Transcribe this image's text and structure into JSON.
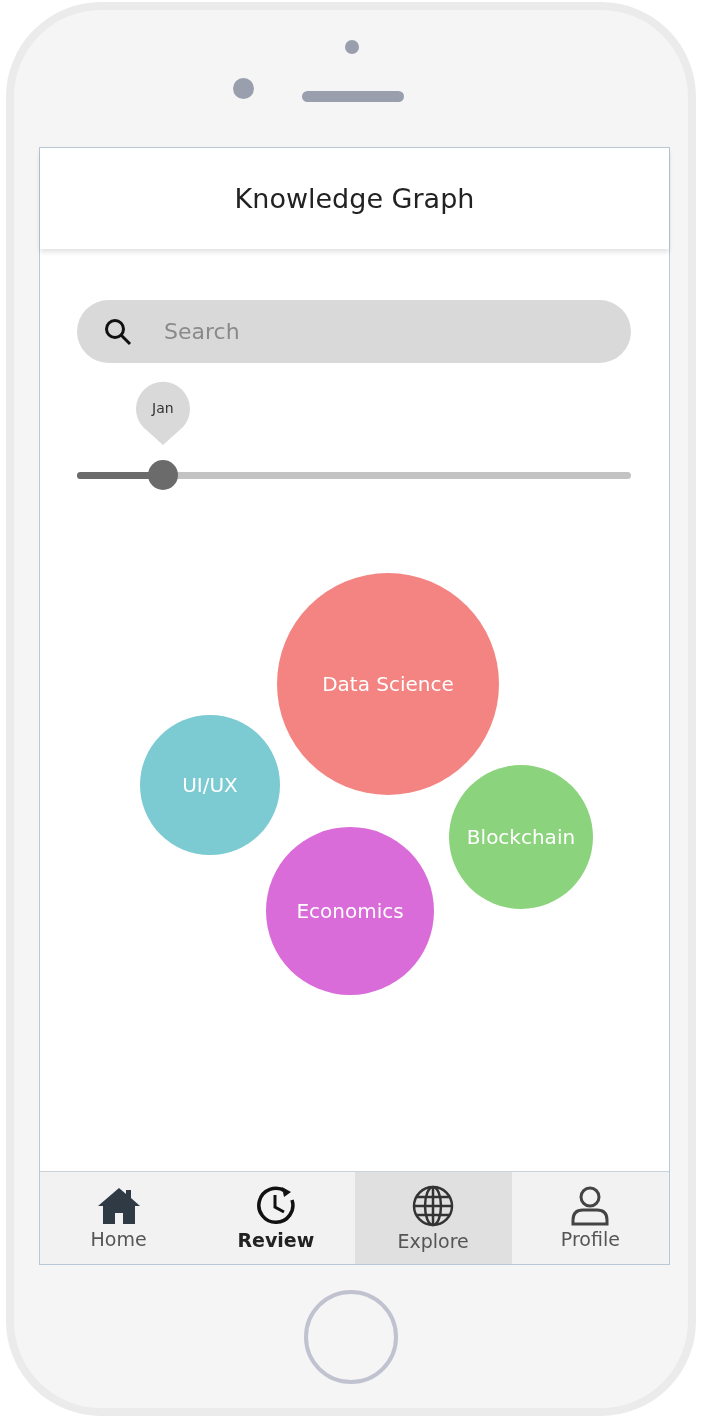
{
  "header": {
    "title": "Knowledge Graph"
  },
  "search": {
    "placeholder": "Search"
  },
  "slider": {
    "label": "Jan",
    "level": 0.155
  },
  "bubbles": [
    {
      "label": "Data Science",
      "color": "#f38481"
    },
    {
      "label": "UI/UX",
      "color": "#7ccad2"
    },
    {
      "label": "Blockchain",
      "color": "#8bd37c"
    },
    {
      "label": "Economics",
      "color": "#d96cd9"
    }
  ],
  "nav": [
    {
      "label": "Home",
      "selected": false,
      "bold": false
    },
    {
      "label": "Review",
      "selected": false,
      "bold": true
    },
    {
      "label": "Explore",
      "selected": true,
      "bold": false
    },
    {
      "label": "Profile",
      "selected": false,
      "bold": false
    }
  ]
}
